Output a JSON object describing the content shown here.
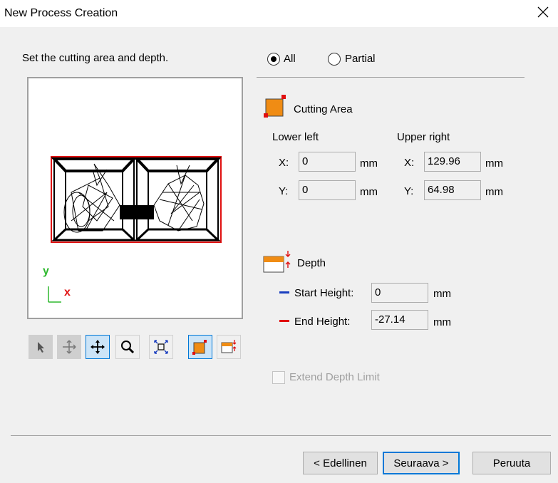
{
  "window": {
    "title": "New Process Creation"
  },
  "instructions": "Set the cutting area and depth.",
  "mode": {
    "all_label": "All",
    "partial_label": "Partial",
    "selected": "All"
  },
  "cutting_area": {
    "label": "Cutting Area",
    "lower_left_label": "Lower left",
    "upper_right_label": "Upper right",
    "x_label": "X:",
    "y_label": "Y:",
    "lower_left_x": "0",
    "lower_left_y": "0",
    "upper_right_x": "129.96",
    "upper_right_y": "64.98",
    "unit": "mm"
  },
  "depth": {
    "label": "Depth",
    "start_label": "Start Height:",
    "start_value": "0",
    "end_label": "End Height:",
    "end_value": "-27.14",
    "unit": "mm"
  },
  "extend_depth_limit": {
    "label": "Extend Depth Limit",
    "checked": false,
    "enabled": false
  },
  "preview_axes": {
    "y": "y",
    "x": "x"
  },
  "toolbar": [
    "select-tool",
    "pan-disabled-tool",
    "move-tool",
    "zoom-tool",
    "fit-view-tool",
    "cutting-area-tool",
    "depth-tool"
  ],
  "buttons": {
    "back": "< Edellinen",
    "next": "Seuraava >",
    "cancel": "Peruuta"
  },
  "colors": {
    "accent": "#0078d7",
    "area_orange": "#f08c14",
    "area_red": "#e01010",
    "start_line": "#1a3fbf",
    "end_line": "#e01010"
  }
}
